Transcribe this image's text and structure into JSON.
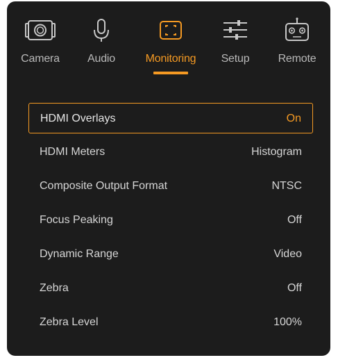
{
  "colors": {
    "accent": "#f59a23",
    "panel_background": "#1c1c1c",
    "text": "#d6d6d6",
    "tab_inactive": "#b9b9b9"
  },
  "tabs": [
    {
      "label": "Camera",
      "icon": "camera-icon",
      "active": false
    },
    {
      "label": "Audio",
      "icon": "microphone-icon",
      "active": false
    },
    {
      "label": "Monitoring",
      "icon": "monitoring-frame-icon",
      "active": true
    },
    {
      "label": "Setup",
      "icon": "sliders-icon",
      "active": false
    },
    {
      "label": "Remote",
      "icon": "remote-control-icon",
      "active": false
    }
  ],
  "settings": [
    {
      "name": "HDMI Overlays",
      "value": "On",
      "selected": true
    },
    {
      "name": "HDMI Meters",
      "value": "Histogram",
      "selected": false
    },
    {
      "name": "Composite Output Format",
      "value": "NTSC",
      "selected": false
    },
    {
      "name": "Focus Peaking",
      "value": "Off",
      "selected": false
    },
    {
      "name": "Dynamic Range",
      "value": "Video",
      "selected": false
    },
    {
      "name": "Zebra",
      "value": "Off",
      "selected": false
    },
    {
      "name": "Zebra Level",
      "value": "100%",
      "selected": false
    }
  ]
}
